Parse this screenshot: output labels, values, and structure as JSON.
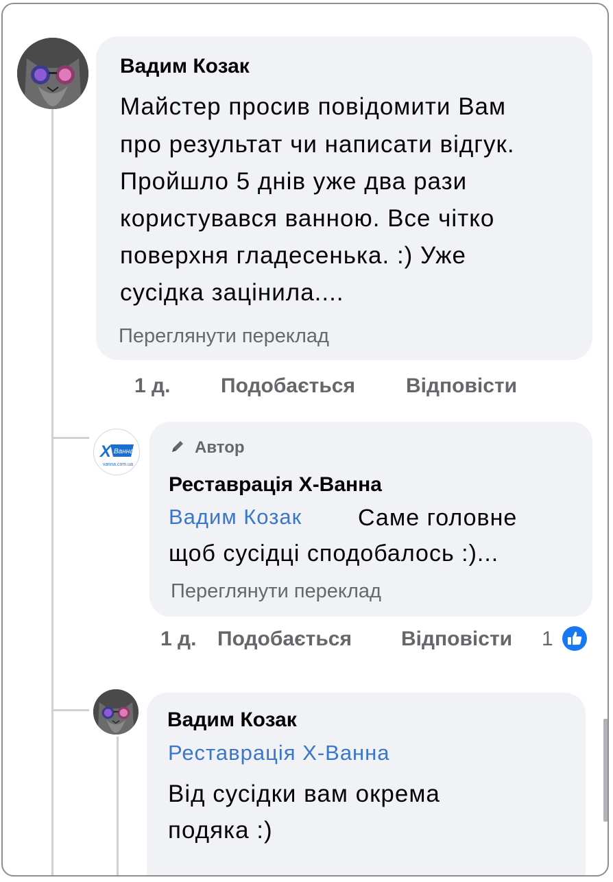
{
  "colors": {
    "bubble": "#f0f2f5",
    "link": "#3a76c9",
    "secondary": "#65676b",
    "like": "#1877f2"
  },
  "comment1": {
    "author": "Вадим Козак",
    "lines": [
      "Майстер просив повідомити Вам",
      "про результат чи написати відгук.",
      "Пройшло 5 днів уже два рази",
      "користувався ванною. Все чітко",
      "поверхня гладесенька.  :) Уже",
      "сусідка зацінила...."
    ],
    "translate": "Переглянути переклад",
    "time": "1 д.",
    "like": "Подобається",
    "reply": "Відповісти"
  },
  "reply1": {
    "author_badge": "Автор",
    "author": "Реставрація X-Ванна",
    "mention": "Вадим Козак",
    "line1": "Саме головне",
    "line2": "щоб сусідці сподобалось :)...",
    "translate": "Переглянути переклад",
    "time": "1 д.",
    "like": "Подобається",
    "reply": "Відповісти",
    "reactions": "1",
    "logo_text": "Ванна",
    "logo_letter": "X",
    "logo_domain": "vanna.com.ua"
  },
  "reply2": {
    "author": "Вадим Козак",
    "mention": "Реставрація X-Ванна",
    "line1": "Від сусідки вам окрема",
    "line2": "подяка :)"
  },
  "icons": {
    "pencil": "pencil-icon",
    "like": "like-thumb-icon"
  }
}
